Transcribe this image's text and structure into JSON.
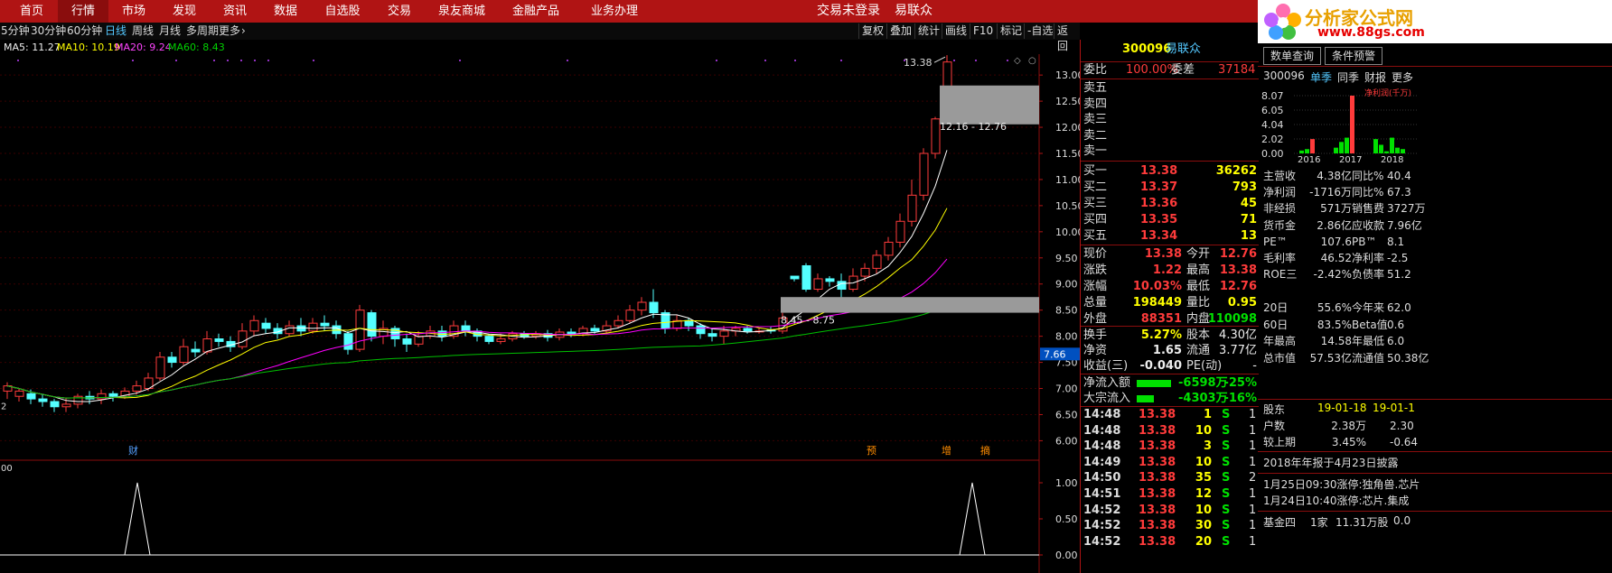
{
  "nav": {
    "items": [
      "首页",
      "行情",
      "市场",
      "发现",
      "资讯",
      "数据",
      "自选股",
      "交易",
      "泉友商城",
      "金融产品",
      "业务办理"
    ],
    "active": "行情",
    "login_status": "交易未登录",
    "app_name": "易联众"
  },
  "logo": {
    "text": "分析家公式网",
    "url_text": "www.88gs.com"
  },
  "toolbar": {
    "periods": [
      "5分钟",
      "30分钟",
      "60分钟",
      "日线",
      "周线",
      "月线",
      "多周期",
      "更多"
    ],
    "active_period": "日线",
    "buttons": [
      "复权",
      "叠加",
      "统计",
      "画线",
      "F10",
      "标记",
      "-自选",
      "返回"
    ]
  },
  "ma": {
    "ma5": "MA5: 11.27",
    "ma10": "MA10: 10.19",
    "ma20": "MA20: 9.24",
    "ma60": "MA60: 8.43"
  },
  "chart_data": {
    "type": "candlestick",
    "y_axis_ticks": [
      "13.00",
      "12.50",
      "12.00",
      "11.50",
      "11.00",
      "10.50",
      "10.00",
      "9.50",
      "9.00",
      "8.50",
      "8.00",
      "7.50",
      "7.00",
      "6.50",
      "6.00"
    ],
    "ylim": [
      5.8,
      13.4
    ],
    "current_price_marker": "7.66",
    "annotations": {
      "high_label": "13.38",
      "range_upper": "12.16 - 12.76",
      "range_lower": "8.45 - 8.75"
    },
    "event_markers": [
      "财",
      "预",
      "增",
      "摘"
    ],
    "sub_axis_ticks": [
      "1.00",
      "0.50",
      "0.00"
    ],
    "sub_left_label": "00",
    "left_tick_label": "2",
    "colors": {
      "ma5": "#ffffff",
      "ma10": "#ffff00",
      "ma20": "#ff00ff",
      "ma60": "#00c000",
      "up": "#ff3b3b",
      "down": "#54ffff"
    },
    "candles": [
      [
        6.95,
        7.05,
        6.8,
        7.12
      ],
      [
        6.85,
        6.95,
        6.75,
        7.0
      ],
      [
        6.9,
        6.8,
        6.7,
        6.98
      ],
      [
        6.8,
        6.75,
        6.65,
        6.9
      ],
      [
        6.75,
        6.65,
        6.55,
        6.8
      ],
      [
        6.65,
        6.7,
        6.55,
        6.82
      ],
      [
        6.7,
        6.85,
        6.62,
        6.9
      ],
      [
        6.85,
        6.8,
        6.7,
        6.95
      ],
      [
        6.8,
        6.9,
        6.7,
        6.98
      ],
      [
        6.9,
        6.85,
        6.75,
        6.95
      ],
      [
        6.85,
        6.95,
        6.8,
        7.02
      ],
      [
        6.95,
        7.05,
        6.88,
        7.15
      ],
      [
        7.0,
        7.2,
        6.95,
        7.3
      ],
      [
        7.2,
        7.6,
        7.15,
        7.7
      ],
      [
        7.6,
        7.5,
        7.4,
        7.7
      ],
      [
        7.5,
        7.8,
        7.45,
        7.95
      ],
      [
        7.75,
        7.7,
        7.6,
        7.9
      ],
      [
        7.7,
        7.95,
        7.65,
        8.1
      ],
      [
        7.95,
        7.9,
        7.8,
        8.05
      ],
      [
        7.9,
        7.8,
        7.7,
        8.0
      ],
      [
        7.8,
        8.1,
        7.75,
        8.25
      ],
      [
        8.1,
        8.3,
        8.0,
        8.4
      ],
      [
        8.25,
        8.15,
        8.05,
        8.35
      ],
      [
        8.15,
        8.05,
        7.95,
        8.25
      ],
      [
        8.05,
        8.2,
        8.0,
        8.3
      ],
      [
        8.2,
        8.1,
        8.0,
        8.35
      ],
      [
        8.1,
        8.25,
        8.05,
        8.35
      ],
      [
        8.25,
        8.2,
        8.1,
        8.4
      ],
      [
        8.2,
        8.05,
        7.95,
        8.3
      ],
      [
        8.05,
        7.75,
        7.65,
        8.1
      ],
      [
        7.75,
        8.5,
        7.7,
        8.6
      ],
      [
        8.45,
        8.0,
        7.9,
        8.5
      ],
      [
        8.0,
        8.15,
        7.85,
        8.3
      ],
      [
        8.15,
        7.95,
        7.8,
        8.2
      ],
      [
        7.95,
        7.85,
        7.7,
        8.05
      ],
      [
        7.85,
        8.0,
        7.8,
        8.1
      ],
      [
        8.0,
        8.1,
        7.95,
        8.2
      ],
      [
        8.1,
        8.0,
        7.9,
        8.2
      ],
      [
        8.0,
        8.2,
        7.95,
        8.3
      ],
      [
        8.2,
        8.1,
        8.0,
        8.3
      ],
      [
        8.1,
        8.0,
        7.9,
        8.15
      ],
      [
        8.0,
        7.9,
        7.85,
        8.05
      ],
      [
        7.9,
        7.95,
        7.85,
        8.05
      ],
      [
        7.95,
        8.05,
        7.9,
        8.1
      ],
      [
        8.05,
        8.0,
        7.95,
        8.1
      ],
      [
        8.0,
        8.05,
        7.95,
        8.1
      ],
      [
        8.05,
        7.98,
        7.9,
        8.12
      ],
      [
        7.98,
        8.08,
        7.92,
        8.15
      ],
      [
        8.08,
        8.05,
        7.98,
        8.15
      ],
      [
        8.05,
        8.15,
        8.0,
        8.2
      ],
      [
        8.15,
        8.1,
        8.05,
        8.22
      ],
      [
        8.1,
        8.2,
        8.05,
        8.3
      ],
      [
        8.2,
        8.3,
        8.15,
        8.4
      ],
      [
        8.3,
        8.5,
        8.25,
        8.6
      ],
      [
        8.5,
        8.65,
        8.4,
        8.75
      ],
      [
        8.65,
        8.45,
        8.35,
        8.9
      ],
      [
        8.45,
        8.15,
        8.05,
        8.5
      ],
      [
        8.15,
        8.3,
        8.1,
        8.4
      ],
      [
        8.3,
        8.2,
        8.1,
        8.35
      ],
      [
        8.2,
        8.05,
        7.95,
        8.25
      ],
      [
        8.05,
        8.0,
        7.9,
        8.15
      ],
      [
        8.0,
        8.1,
        7.85,
        8.2
      ],
      [
        8.1,
        8.15,
        8.0,
        8.2
      ],
      [
        8.15,
        8.1,
        8.05,
        8.2
      ],
      [
        8.1,
        8.1,
        8.05,
        8.15
      ],
      [
        8.12,
        8.1,
        8.05,
        8.18
      ],
      [
        8.1,
        8.35,
        8.05,
        8.45
      ],
      [
        9.15,
        9.1,
        9.05,
        9.15
      ],
      [
        9.35,
        8.9,
        8.85,
        9.4
      ],
      [
        8.9,
        9.1,
        8.85,
        9.2
      ],
      [
        9.1,
        9.05,
        8.95,
        9.15
      ],
      [
        9.05,
        8.9,
        8.7,
        9.2
      ],
      [
        8.9,
        9.15,
        8.85,
        9.3
      ],
      [
        9.15,
        9.3,
        9.05,
        9.4
      ],
      [
        9.3,
        9.55,
        9.2,
        9.65
      ],
      [
        9.55,
        9.8,
        9.45,
        9.9
      ],
      [
        9.8,
        10.2,
        9.7,
        10.35
      ],
      [
        10.2,
        10.7,
        10.1,
        11.0
      ],
      [
        10.7,
        11.5,
        10.6,
        11.6
      ],
      [
        11.5,
        12.16,
        11.4,
        12.2
      ],
      [
        12.16,
        13.25,
        12.16,
        13.38
      ]
    ]
  },
  "quote": {
    "code": "300096",
    "name": "易联众",
    "weibi_label": "委比",
    "weibi": "100.00%",
    "weicha_label": "委差",
    "weicha": "37184",
    "sell": [
      {
        "label": "卖五",
        "price": "",
        "vol": ""
      },
      {
        "label": "卖四",
        "price": "",
        "vol": ""
      },
      {
        "label": "卖三",
        "price": "",
        "vol": ""
      },
      {
        "label": "卖二",
        "price": "",
        "vol": ""
      },
      {
        "label": "卖一",
        "price": "",
        "vol": ""
      }
    ],
    "buy": [
      {
        "label": "买一",
        "price": "13.38",
        "vol": "36262"
      },
      {
        "label": "买二",
        "price": "13.37",
        "vol": "793"
      },
      {
        "label": "买三",
        "price": "13.36",
        "vol": "45"
      },
      {
        "label": "买四",
        "price": "13.35",
        "vol": "71"
      },
      {
        "label": "买五",
        "price": "13.34",
        "vol": "13"
      }
    ],
    "stats": [
      {
        "l1": "现价",
        "v1": "13.38",
        "c1": "red",
        "l2": "今开",
        "v2": "12.76",
        "c2": "red"
      },
      {
        "l1": "涨跌",
        "v1": "1.22",
        "c1": "red",
        "l2": "最高",
        "v2": "13.38",
        "c2": "red"
      },
      {
        "l1": "涨幅",
        "v1": "10.03%",
        "c1": "red",
        "l2": "最低",
        "v2": "12.76",
        "c2": "red"
      },
      {
        "l1": "总量",
        "v1": "198449",
        "c1": "yellow",
        "l2": "量比",
        "v2": "0.95",
        "c2": "yellow"
      },
      {
        "l1": "外盘",
        "v1": "88351",
        "c1": "red",
        "l2": "内盘",
        "v2": "110098",
        "c2": "green"
      }
    ],
    "stats2": [
      {
        "l1": "换手",
        "v1": "5.27%",
        "c1": "yellow",
        "l2": "股本",
        "v2": "4.30亿",
        "c2": "white"
      },
      {
        "l1": "净资",
        "v1": "1.65",
        "c1": "white",
        "l2": "流通",
        "v2": "3.77亿",
        "c2": "white"
      },
      {
        "l1": "收益(三)",
        "v1": "-0.040",
        "c1": "white",
        "l2": "PE(动)",
        "v2": "-",
        "c2": "white"
      }
    ],
    "flow": [
      {
        "label": "净流入额",
        "value": "-6598万",
        "pct": "-25%",
        "bar": 0.6
      },
      {
        "label": "大宗流入",
        "value": "-4303万",
        "pct": "-16%",
        "bar": 0.3
      }
    ],
    "ticks": [
      {
        "time": "14:48",
        "price": "13.38",
        "vol": "1",
        "side": "S",
        "n": "1"
      },
      {
        "time": "14:48",
        "price": "13.38",
        "vol": "10",
        "side": "S",
        "n": "1"
      },
      {
        "time": "14:48",
        "price": "13.38",
        "vol": "3",
        "side": "S",
        "n": "1"
      },
      {
        "time": "14:49",
        "price": "13.38",
        "vol": "10",
        "side": "S",
        "n": "1"
      },
      {
        "time": "14:50",
        "price": "13.38",
        "vol": "35",
        "side": "S",
        "n": "2"
      },
      {
        "time": "14:51",
        "price": "13.38",
        "vol": "12",
        "side": "S",
        "n": "1"
      },
      {
        "time": "14:52",
        "price": "13.38",
        "vol": "10",
        "side": "S",
        "n": "1"
      },
      {
        "time": "14:52",
        "price": "13.38",
        "vol": "30",
        "side": "S",
        "n": "1"
      },
      {
        "time": "14:52",
        "price": "13.38",
        "vol": "20",
        "side": "S",
        "n": "1"
      }
    ]
  },
  "f10": {
    "btn1": "数单查询",
    "btn2": "条件预警",
    "code": "300096",
    "tabs": [
      "单季",
      "同季",
      "财报",
      "更多"
    ],
    "bar_chart": {
      "y_ticks": [
        "8.07",
        "6.05",
        "4.04",
        "2.02",
        "0.00"
      ],
      "legend": "净利润(千万)",
      "years": [
        "2016",
        "2017",
        "2018"
      ]
    },
    "fin": [
      {
        "l1": "主营收",
        "v1": "4.38亿",
        "l2": "同比%",
        "v2": "40.4"
      },
      {
        "l1": "净利润",
        "v1": "-1716万",
        "l2": "同比%",
        "v2": "67.3"
      },
      {
        "l1": "非经损",
        "v1": "571万",
        "l2": "销售费",
        "v2": "3727万"
      },
      {
        "l1": "货币金",
        "v1": "2.86亿",
        "l2": "应收款",
        "v2": "7.96亿"
      },
      {
        "l1": "PE™",
        "v1": "107.6",
        "l2": "PB™",
        "v2": "8.1"
      },
      {
        "l1": "毛利率",
        "v1": "46.52",
        "l2": "净利率",
        "v2": "-2.5"
      },
      {
        "l1": "ROE三",
        "v1": "-2.42%",
        "l2": "负债率",
        "v2": "51.2"
      }
    ],
    "perf": [
      {
        "l1": "20日",
        "v1": "55.6%",
        "l2": "今年来",
        "v2": "62.0"
      },
      {
        "l1": "60日",
        "v1": "83.5%",
        "l2": "Beta值",
        "v2": "0.6"
      },
      {
        "l1": "年最高",
        "v1": "14.58",
        "l2": "年最低",
        "v2": "6.0"
      },
      {
        "l1": "总市值",
        "v1": "57.53亿",
        "l2": "流通值",
        "v2": "50.38亿"
      }
    ],
    "holders": {
      "label": "股东",
      "d1": "19-01-18",
      "d2": "19-01-1",
      "rows": [
        {
          "l": "户数",
          "v1": "2.38万",
          "v2": "2.30"
        },
        {
          "l": "较上期",
          "v1": "3.45%",
          "v2": "-0.64"
        }
      ]
    },
    "notice": "2018年年报于4月23日披露",
    "news": [
      "1月25日09:30涨停:独角兽.芯片",
      "1月24日10:40涨停:芯片.集成"
    ],
    "fund": {
      "label": "基金四",
      "a": "1家",
      "b": "11.31万股",
      "c": "0.0"
    }
  }
}
